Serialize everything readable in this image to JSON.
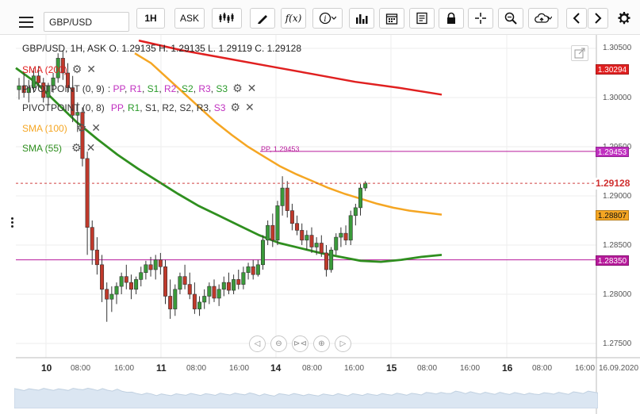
{
  "toolbar": {
    "symbol": "GBP/USD",
    "timeframe": "1H",
    "price_type": "ASK",
    "fx_label": "f(x)"
  },
  "legend": {
    "ohlc": "GBP/USD, 1H, ASK   O. 1.29135 H. 1.29135 L. 1.29119 C. 1.29128",
    "sma200": "SMA (200)",
    "pivot9": "PIVOTPOINT (0, 9)",
    "pivot8": "PIVOTPOINT (0, 8)",
    "pivot_levels": [
      {
        "text": ": ",
        "color": "#333333"
      },
      {
        "text": "PP",
        "color": "#c030c0"
      },
      {
        "text": ", ",
        "color": "#333333"
      },
      {
        "text": "R1",
        "color": "#c030c0"
      },
      {
        "text": ", ",
        "color": "#333333"
      },
      {
        "text": "S1",
        "color": "#2a9a2a"
      },
      {
        "text": ", ",
        "color": "#333333"
      },
      {
        "text": "R2",
        "color": "#c030c0"
      },
      {
        "text": ", ",
        "color": "#333333"
      },
      {
        "text": "S2",
        "color": "#2a9a2a"
      },
      {
        "text": ", ",
        "color": "#333333"
      },
      {
        "text": "R3",
        "color": "#c030c0"
      },
      {
        "text": ", ",
        "color": "#333333"
      },
      {
        "text": "S3",
        "color": "#2a9a2a"
      }
    ],
    "pivot_levels2": [
      {
        "text": "PP",
        "color": "#c030c0"
      },
      {
        "text": ", ",
        "color": "#333333"
      },
      {
        "text": "R1",
        "color": "#2a9a2a"
      },
      {
        "text": ", ",
        "color": "#333333"
      },
      {
        "text": "S1",
        "color": "#333333"
      },
      {
        "text": ", ",
        "color": "#333333"
      },
      {
        "text": "R2",
        "color": "#333333"
      },
      {
        "text": ", ",
        "color": "#333333"
      },
      {
        "text": "S2",
        "color": "#333333"
      },
      {
        "text": ", ",
        "color": "#333333"
      },
      {
        "text": "R3",
        "color": "#333333"
      },
      {
        "text": ", ",
        "color": "#333333"
      },
      {
        "text": "S3",
        "color": "#c030c0"
      }
    ],
    "sma100": "SMA (100)",
    "sma55": "SMA (55)"
  },
  "pp_label": "PP, 1.29453",
  "price_axis": {
    "ticks": [
      "1.30500",
      "1.30000",
      "1.29500",
      "1.29000",
      "1.28500",
      "1.28000",
      "1.27500"
    ],
    "tags": [
      {
        "value": "1.30294",
        "bg": "#e02020",
        "fg": "#ffffff"
      },
      {
        "value": "1.29453",
        "bg": "#c030c0",
        "fg": "#ffffff"
      },
      {
        "value": "1.29128",
        "bg": "#ffffff",
        "fg": "#d03030"
      },
      {
        "value": "1.28807",
        "bg": "#f5a623",
        "fg": "#111111"
      },
      {
        "value": "1.28350",
        "bg": "#b71a9b",
        "fg": "#ffffff"
      }
    ]
  },
  "time_axis": [
    {
      "label": "10",
      "day": true
    },
    {
      "label": "08:00",
      "day": false
    },
    {
      "label": "16:00",
      "day": false
    },
    {
      "label": "11",
      "day": true
    },
    {
      "label": "08:00",
      "day": false
    },
    {
      "label": "16:00",
      "day": false
    },
    {
      "label": "14",
      "day": true
    },
    {
      "label": "08:00",
      "day": false
    },
    {
      "label": "16:00",
      "day": false
    },
    {
      "label": "15",
      "day": true
    },
    {
      "label": "08:00",
      "day": false
    },
    {
      "label": "16:00",
      "day": false
    },
    {
      "label": "16",
      "day": true
    },
    {
      "label": "08:00",
      "day": false
    },
    {
      "label": "16:00",
      "day": false
    },
    {
      "label": "16.09.2020",
      "day": false
    }
  ],
  "colors": {
    "sma200": "#e02020",
    "sma100": "#f5a623",
    "sma55": "#2f8f1f",
    "pivot": "#b71a9b",
    "bull": "#3a9a3a",
    "bear": "#c0392b"
  },
  "chart_data": {
    "type": "candlestick",
    "symbol": "GBP/USD",
    "timeframe": "1H",
    "ylim": [
      1.2735,
      1.3065
    ],
    "candles": [
      [
        1.3008,
        1.302,
        1.2998,
        1.3012
      ],
      [
        1.3012,
        1.3025,
        1.3,
        1.3005
      ],
      [
        1.3005,
        1.3018,
        1.2995,
        1.301
      ],
      [
        1.301,
        1.303,
        1.3005,
        1.3022
      ],
      [
        1.3022,
        1.3032,
        1.301,
        1.3015
      ],
      [
        1.3015,
        1.302,
        1.2995,
        1.3
      ],
      [
        1.3,
        1.3015,
        1.2992,
        1.3012
      ],
      [
        1.3012,
        1.3025,
        1.3005,
        1.302
      ],
      [
        1.302,
        1.3045,
        1.3015,
        1.304
      ],
      [
        1.304,
        1.3048,
        1.3018,
        1.3025
      ],
      [
        1.3025,
        1.3035,
        1.3005,
        1.301
      ],
      [
        1.301,
        1.3022,
        1.2975,
        1.2982
      ],
      [
        1.2982,
        1.2995,
        1.2965,
        1.2985
      ],
      [
        1.2985,
        1.299,
        1.293,
        1.2938
      ],
      [
        1.2938,
        1.2945,
        1.284,
        1.2868
      ],
      [
        1.2868,
        1.2875,
        1.283,
        1.2845
      ],
      [
        1.2845,
        1.2858,
        1.282,
        1.283
      ],
      [
        1.283,
        1.284,
        1.2792,
        1.2805
      ],
      [
        1.2805,
        1.2812,
        1.2772,
        1.2795
      ],
      [
        1.2795,
        1.2808,
        1.2782,
        1.28
      ],
      [
        1.28,
        1.2812,
        1.279,
        1.2808
      ],
      [
        1.2808,
        1.2822,
        1.28,
        1.2818
      ],
      [
        1.2818,
        1.283,
        1.2805,
        1.2812
      ],
      [
        1.2812,
        1.282,
        1.2795,
        1.2805
      ],
      [
        1.2805,
        1.2818,
        1.28,
        1.2815
      ],
      [
        1.2815,
        1.2828,
        1.2808,
        1.2822
      ],
      [
        1.2822,
        1.2834,
        1.2815,
        1.283
      ],
      [
        1.283,
        1.2838,
        1.2818,
        1.2825
      ],
      [
        1.2825,
        1.284,
        1.2815,
        1.2835
      ],
      [
        1.2835,
        1.2842,
        1.282,
        1.2828
      ],
      [
        1.2828,
        1.2835,
        1.279,
        1.2798
      ],
      [
        1.2798,
        1.2815,
        1.2775,
        1.2785
      ],
      [
        1.2785,
        1.281,
        1.2778,
        1.2805
      ],
      [
        1.2805,
        1.2822,
        1.28,
        1.2818
      ],
      [
        1.2818,
        1.283,
        1.2805,
        1.281
      ],
      [
        1.281,
        1.2822,
        1.2795,
        1.28
      ],
      [
        1.28,
        1.2812,
        1.278,
        1.2785
      ],
      [
        1.2785,
        1.2798,
        1.2778,
        1.2792
      ],
      [
        1.2792,
        1.2805,
        1.2785,
        1.2798
      ],
      [
        1.2798,
        1.2812,
        1.279,
        1.2808
      ],
      [
        1.2808,
        1.2815,
        1.2792,
        1.2796
      ],
      [
        1.2796,
        1.281,
        1.2788,
        1.2805
      ],
      [
        1.2805,
        1.2818,
        1.2798,
        1.2812
      ],
      [
        1.2812,
        1.2822,
        1.28,
        1.2804
      ],
      [
        1.2804,
        1.282,
        1.28,
        1.2815
      ],
      [
        1.2815,
        1.2825,
        1.2805,
        1.281
      ],
      [
        1.281,
        1.2828,
        1.2805,
        1.2822
      ],
      [
        1.2822,
        1.2832,
        1.2815,
        1.2828
      ],
      [
        1.2828,
        1.2835,
        1.2815,
        1.282
      ],
      [
        1.282,
        1.2835,
        1.2818,
        1.283
      ],
      [
        1.283,
        1.286,
        1.2825,
        1.2855
      ],
      [
        1.2855,
        1.2875,
        1.285,
        1.287
      ],
      [
        1.287,
        1.2882,
        1.2848,
        1.2855
      ],
      [
        1.2855,
        1.2895,
        1.285,
        1.289
      ],
      [
        1.289,
        1.292,
        1.288,
        1.2908
      ],
      [
        1.2908,
        1.2915,
        1.2878,
        1.2885
      ],
      [
        1.2885,
        1.2892,
        1.2865,
        1.2872
      ],
      [
        1.2872,
        1.288,
        1.286,
        1.2865
      ],
      [
        1.2865,
        1.2872,
        1.285,
        1.2855
      ],
      [
        1.2855,
        1.2865,
        1.2845,
        1.286
      ],
      [
        1.286,
        1.2868,
        1.2842,
        1.2848
      ],
      [
        1.2848,
        1.2858,
        1.284,
        1.2852
      ],
      [
        1.2852,
        1.286,
        1.2838,
        1.2842
      ],
      [
        1.2842,
        1.285,
        1.2818,
        1.2825
      ],
      [
        1.2825,
        1.2848,
        1.2822,
        1.2845
      ],
      [
        1.2845,
        1.2862,
        1.284,
        1.2858
      ],
      [
        1.2858,
        1.2868,
        1.2848,
        1.2862
      ],
      [
        1.2862,
        1.287,
        1.285,
        1.2855
      ],
      [
        1.2855,
        1.2885,
        1.285,
        1.288
      ],
      [
        1.288,
        1.2892,
        1.287,
        1.2888
      ],
      [
        1.2888,
        1.2912,
        1.288,
        1.2908
      ],
      [
        1.2908,
        1.2915,
        1.2905,
        1.2913
      ]
    ],
    "sma200": [
      1.3058,
      1.3048,
      1.304,
      1.3032,
      1.3024,
      1.3016,
      1.301,
      1.3003
    ],
    "sma100": [
      1.3045,
      1.3035,
      1.302,
      1.3005,
      1.299,
      1.2975,
      1.2962,
      1.295,
      1.294,
      1.293,
      1.2922,
      1.2915,
      1.2908,
      1.2902,
      1.2897,
      1.2892,
      1.2888,
      1.2885,
      1.2883,
      1.2881
    ],
    "sma55": [
      1.303,
      1.3015,
      1.2995,
      1.2975,
      1.2958,
      1.2942,
      1.2928,
      1.2915,
      1.2902,
      1.289,
      1.288,
      1.287,
      1.286,
      1.2852,
      1.2847,
      1.2842,
      1.2838,
      1.2834,
      1.2833,
      1.2835,
      1.2838,
      1.284
    ],
    "pivot_pp": 1.29453,
    "pivot_s": 1.2835,
    "last_price": 1.29128
  }
}
